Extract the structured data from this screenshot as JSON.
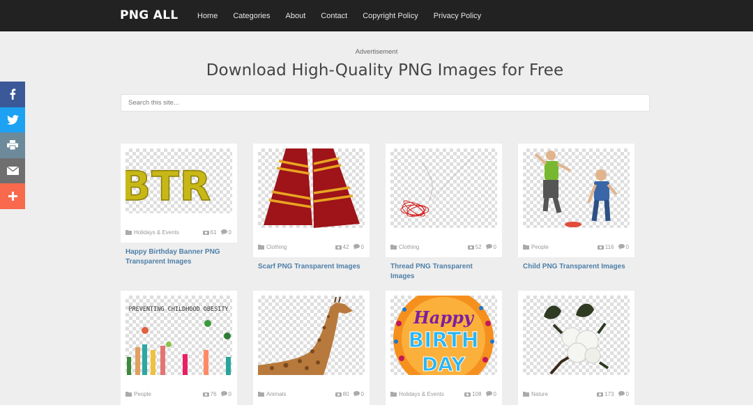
{
  "brand": "PNG ALL",
  "nav": [
    "Home",
    "Categories",
    "About",
    "Contact",
    "Copyright Policy",
    "Privacy Policy"
  ],
  "ad_label": "Advertisement",
  "page_title": "Download High-Quality PNG Images for Free",
  "search_placeholder": "Search this site...",
  "social": [
    "facebook",
    "twitter",
    "print",
    "email",
    "more"
  ],
  "cards": [
    {
      "category": "Holidays & Events",
      "views": "61",
      "comments": "0",
      "title": "Happy Birthday Banner PNG Transparent Images"
    },
    {
      "category": "Clothing",
      "views": "42",
      "comments": "0",
      "title": "Scarf PNG Transparent Images"
    },
    {
      "category": "Clothing",
      "views": "52",
      "comments": "0",
      "title": "Thread PNG Transparent Images"
    },
    {
      "category": "People",
      "views": "116",
      "comments": "0",
      "title": "Child PNG Transparent Images"
    },
    {
      "category": "People",
      "views": "76",
      "comments": "0",
      "title": ""
    },
    {
      "category": "Animals",
      "views": "80",
      "comments": "0",
      "title": ""
    },
    {
      "category": "Holidays & Events",
      "views": "108",
      "comments": "0",
      "title": ""
    },
    {
      "category": "Nature",
      "views": "173",
      "comments": "0",
      "title": ""
    }
  ],
  "image_texts": {
    "birthday_banner": "BTR",
    "obesity_poster": "PREVENTING CHILDHOOD OBESITY",
    "balloon": [
      "Happy",
      "BIRTH",
      "DAY"
    ]
  },
  "colors": {
    "topbar": "#222222",
    "link": "#4e7fa8",
    "facebook": "#3b5998",
    "twitter": "#1da1f2",
    "print": "#6d8a9a",
    "email": "#6f6f6f",
    "more": "#f8694d"
  }
}
